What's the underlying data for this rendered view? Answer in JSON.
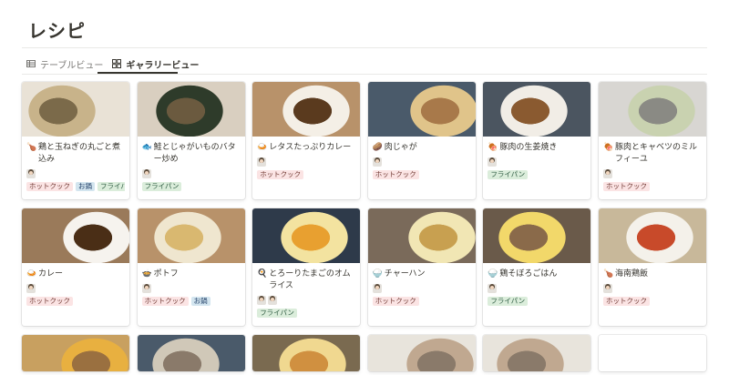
{
  "page": {
    "title": "レシピ"
  },
  "tabs": [
    {
      "label": "テーブルビュー",
      "icon": "table-icon",
      "active": false
    },
    {
      "label": "ギャラリービュー",
      "icon": "gallery-icon",
      "active": true
    }
  ],
  "tag_colors": {
    "ホットクック": "#fbe4e4",
    "フライパン": "#dbeddb",
    "お鍋": "#d3e5ef"
  },
  "cards": [
    {
      "emoji": "🍗",
      "name": "鶏と玉ねぎの丸ごと煮込み",
      "avatars": 1,
      "tags": [
        "ホットクック",
        "お鍋",
        "フライパン"
      ],
      "photo": [
        "#e9e2d6",
        "#c8b38a",
        "#7b6a4a"
      ]
    },
    {
      "emoji": "🐟",
      "name": "鮭とじゃがいものバター炒め",
      "avatars": 1,
      "tags": [
        "フライパン"
      ],
      "photo": [
        "#d9cfc0",
        "#2e3b2a",
        "#6b5a3f"
      ]
    },
    {
      "emoji": "🍛",
      "name": "レタスたっぷりカレー",
      "avatars": 1,
      "tags": [
        "ホットクック"
      ],
      "photo": [
        "#b8926a",
        "#f4efe6",
        "#5a3a1e"
      ]
    },
    {
      "emoji": "🥔",
      "name": "肉じゃが",
      "avatars": 1,
      "tags": [
        "ホットクック"
      ],
      "photo": [
        "#4a5a6a",
        "#e0c48a",
        "#a8794a"
      ]
    },
    {
      "emoji": "🍖",
      "name": "豚肉の生姜焼き",
      "avatars": 1,
      "tags": [
        "フライパン"
      ],
      "photo": [
        "#4b5560",
        "#f1ede6",
        "#8a5a30"
      ]
    },
    {
      "emoji": "🍖",
      "name": "豚肉とキャベツのミルフィーユ",
      "avatars": 1,
      "tags": [
        "ホットクック"
      ],
      "photo": [
        "#d8d6d2",
        "#c9d2b0",
        "#8a8a84"
      ]
    },
    {
      "emoji": "🍛",
      "name": "カレー",
      "avatars": 1,
      "tags": [
        "ホットクック"
      ],
      "photo": [
        "#9a7a5a",
        "#f6f3ee",
        "#4a2e16"
      ]
    },
    {
      "emoji": "🍲",
      "name": "ポトフ",
      "avatars": 1,
      "tags": [
        "ホットクック",
        "お鍋"
      ],
      "photo": [
        "#b8926a",
        "#efe6cf",
        "#d9b870"
      ]
    },
    {
      "emoji": "🍳",
      "name": "とろーりたまごのオムライス",
      "avatars": 2,
      "tags": [
        "フライパン"
      ],
      "photo": [
        "#2e3a4a",
        "#f3e3a0",
        "#e8a030"
      ]
    },
    {
      "emoji": "🍚",
      "name": "チャーハン",
      "avatars": 1,
      "tags": [
        "ホットクック"
      ],
      "photo": [
        "#7a6a5a",
        "#f1e6b4",
        "#c8a050"
      ]
    },
    {
      "emoji": "🍚",
      "name": "鶏そぼろごはん",
      "avatars": 1,
      "tags": [
        "フライパン"
      ],
      "photo": [
        "#6a5a4a",
        "#f2d86a",
        "#8a6a4a"
      ]
    },
    {
      "emoji": "🍗",
      "name": "海南鶏飯",
      "avatars": 1,
      "tags": [
        "ホットクック"
      ],
      "photo": [
        "#c8b89a",
        "#f4f1ea",
        "#c84a2a"
      ]
    },
    {
      "emoji": "",
      "name": "",
      "avatars": 0,
      "tags": [],
      "photo": [
        "#c8a060",
        "#e8b040",
        "#9a7040"
      ]
    },
    {
      "emoji": "",
      "name": "",
      "avatars": 0,
      "tags": [],
      "photo": [
        "#4a5a6a",
        "#d0c8b8",
        "#8a7a6a"
      ]
    },
    {
      "emoji": "",
      "name": "",
      "avatars": 0,
      "tags": [],
      "photo": [
        "#7a6a50",
        "#f0d890",
        "#d09040"
      ]
    },
    {
      "emoji": "",
      "name": "",
      "avatars": 0,
      "tags": [],
      "photo": [
        "#e8e4dc",
        "#c0a890",
        "#8a7a6a"
      ]
    },
    {
      "emoji": "",
      "name": "",
      "avatars": 0,
      "tags": [],
      "photo": [
        "#e8e4dc",
        "#c0a890",
        "#8a7a6a"
      ]
    },
    {
      "emoji": "",
      "name": "",
      "avatars": 0,
      "tags": [],
      "photo": [
        "#ffffff",
        "#ffffff",
        "#ffffff"
      ]
    }
  ]
}
